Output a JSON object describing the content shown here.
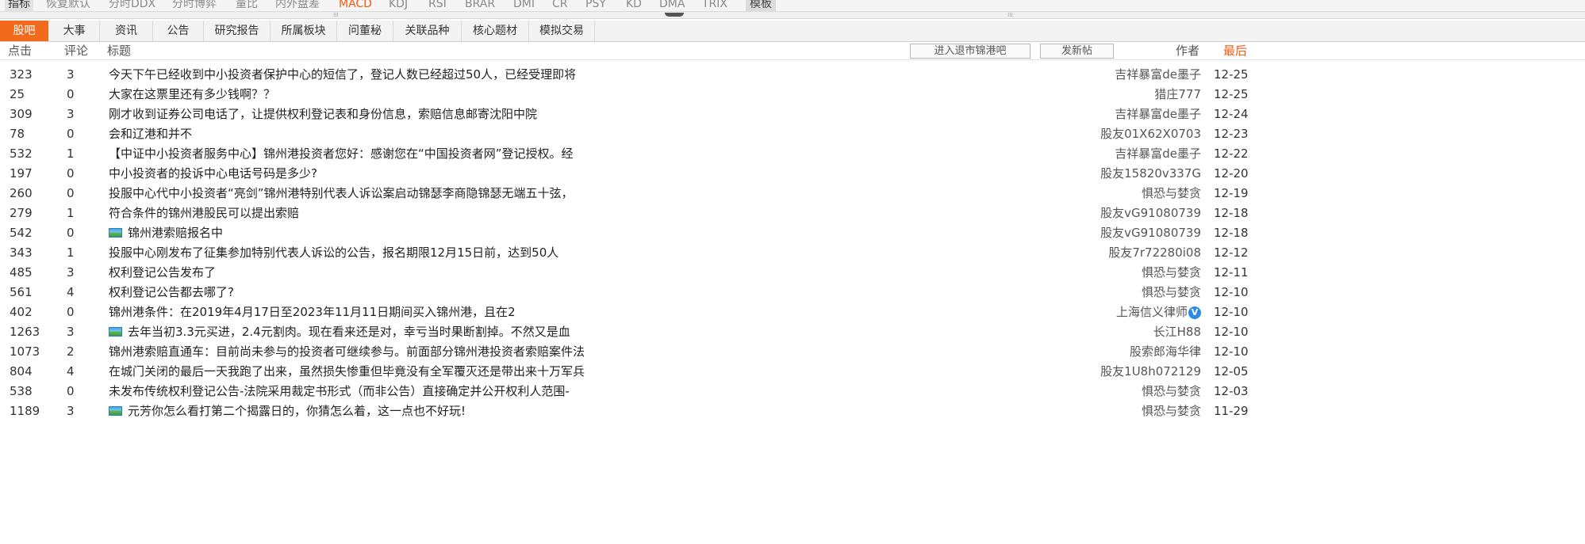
{
  "indicator_bar": {
    "items": [
      "指标",
      "恢复默认",
      "分时DDX",
      "分时博弈",
      "量比",
      "内外盘差",
      "MACD",
      "KDJ",
      "RSI",
      "BRAR",
      "DMI",
      "CR",
      "PSY",
      "KD",
      "DMA",
      "TRIX"
    ],
    "template_label": "模板"
  },
  "tabs": [
    "股吧",
    "大事",
    "资讯",
    "公告",
    "研究报告",
    "所属板块",
    "问董秘",
    "关联品种",
    "核心题材",
    "模拟交易"
  ],
  "columns": {
    "clicks": "点击",
    "comments": "评论",
    "title": "标题",
    "author": "作者",
    "latest": "最后"
  },
  "buttons": {
    "enter_bar": "进入退市锦港吧",
    "new_post": "发新帖"
  },
  "colors": {
    "accent": "#f26b1d",
    "highlight_text": "#f05a14"
  },
  "posts": [
    {
      "clicks": "323",
      "comments": "3",
      "title": "今天下午已经收到中小投资者保护中心的短信了，登记人数已经超过50人，已经受理即将",
      "has_image": false,
      "author": "吉祥暴富de墨子",
      "verified": false,
      "date": "12-25"
    },
    {
      "clicks": "25",
      "comments": "0",
      "title": "大家在这票里还有多少钱啊？？",
      "has_image": false,
      "author": "猎庄777",
      "verified": false,
      "date": "12-25"
    },
    {
      "clicks": "309",
      "comments": "3",
      "title": "刚才收到证券公司电话了，让提供权利登记表和身份信息，索赔信息邮寄沈阳中院",
      "has_image": false,
      "author": "吉祥暴富de墨子",
      "verified": false,
      "date": "12-24"
    },
    {
      "clicks": "78",
      "comments": "0",
      "title": "会和辽港和并不",
      "has_image": false,
      "author": "股友01X62X0703",
      "verified": false,
      "date": "12-23"
    },
    {
      "clicks": "532",
      "comments": "1",
      "title": "【中证中小投资者服务中心】锦州港投资者您好：感谢您在“中国投资者网”登记授权。经",
      "has_image": false,
      "author": "吉祥暴富de墨子",
      "verified": false,
      "date": "12-22"
    },
    {
      "clicks": "197",
      "comments": "0",
      "title": "中小投资者的投诉中心电话号码是多少?",
      "has_image": false,
      "author": "股友15820v337G",
      "verified": false,
      "date": "12-20"
    },
    {
      "clicks": "260",
      "comments": "0",
      "title": "投服中心代中小投资者“亮剑”锦州港特别代表人诉讼案启动锦瑟李商隐锦瑟无端五十弦，",
      "has_image": false,
      "author": "惧恐与婪贪",
      "verified": false,
      "date": "12-19"
    },
    {
      "clicks": "279",
      "comments": "1",
      "title": "符合条件的锦州港股民可以提出索赔",
      "has_image": false,
      "author": "股友vG91080739",
      "verified": false,
      "date": "12-18"
    },
    {
      "clicks": "542",
      "comments": "0",
      "title": "锦州港索赔报名中",
      "has_image": true,
      "author": "股友vG91080739",
      "verified": false,
      "date": "12-18"
    },
    {
      "clicks": "343",
      "comments": "1",
      "title": "投服中心刚发布了征集参加特别代表人诉讼的公告，报名期限12月15日前，达到50人",
      "has_image": false,
      "author": "股友7r72280i08",
      "verified": false,
      "date": "12-12"
    },
    {
      "clicks": "485",
      "comments": "3",
      "title": "权利登记公告发布了",
      "has_image": false,
      "author": "惧恐与婪贪",
      "verified": false,
      "date": "12-11"
    },
    {
      "clicks": "561",
      "comments": "4",
      "title": "权利登记公告都去哪了?",
      "has_image": false,
      "author": "惧恐与婪贪",
      "verified": false,
      "date": "12-10"
    },
    {
      "clicks": "402",
      "comments": "0",
      "title": "锦州港条件：在2019年4月17日至2023年11月11日期间买入锦州港，且在2",
      "has_image": false,
      "author": "上海信义律师",
      "verified": true,
      "date": "12-10"
    },
    {
      "clicks": "1263",
      "comments": "3",
      "title": "去年当初3.3元买进，2.4元割肉。现在看来还是对，幸亏当时果断割掉。不然又是血",
      "has_image": true,
      "author": "长江H88",
      "verified": false,
      "date": "12-10"
    },
    {
      "clicks": "1073",
      "comments": "2",
      "title": "锦州港索赔直通车：目前尚未参与的投资者可继续参与。前面部分锦州港投资者索赔案件法",
      "has_image": false,
      "author": "股索郎海华律",
      "verified": false,
      "date": "12-10"
    },
    {
      "clicks": "804",
      "comments": "4",
      "title": "在城门关闭的最后一天我跑了出来，虽然损失惨重但毕竟没有全军覆灭还是带出来十万军兵",
      "has_image": false,
      "author": "股友1U8h072129",
      "verified": false,
      "date": "12-05"
    },
    {
      "clicks": "538",
      "comments": "0",
      "title": "未发布传统权利登记公告-法院采用裁定书形式（而非公告）直接确定并公开权利人范围-",
      "has_image": false,
      "author": "惧恐与婪贪",
      "verified": false,
      "date": "12-03"
    },
    {
      "clicks": "1189",
      "comments": "3",
      "title": "元芳你怎么看打第二个揭露日的，你猜怎么着，这一点也不好玩!",
      "has_image": true,
      "author": "惧恐与婪贪",
      "verified": false,
      "date": "11-29"
    }
  ]
}
